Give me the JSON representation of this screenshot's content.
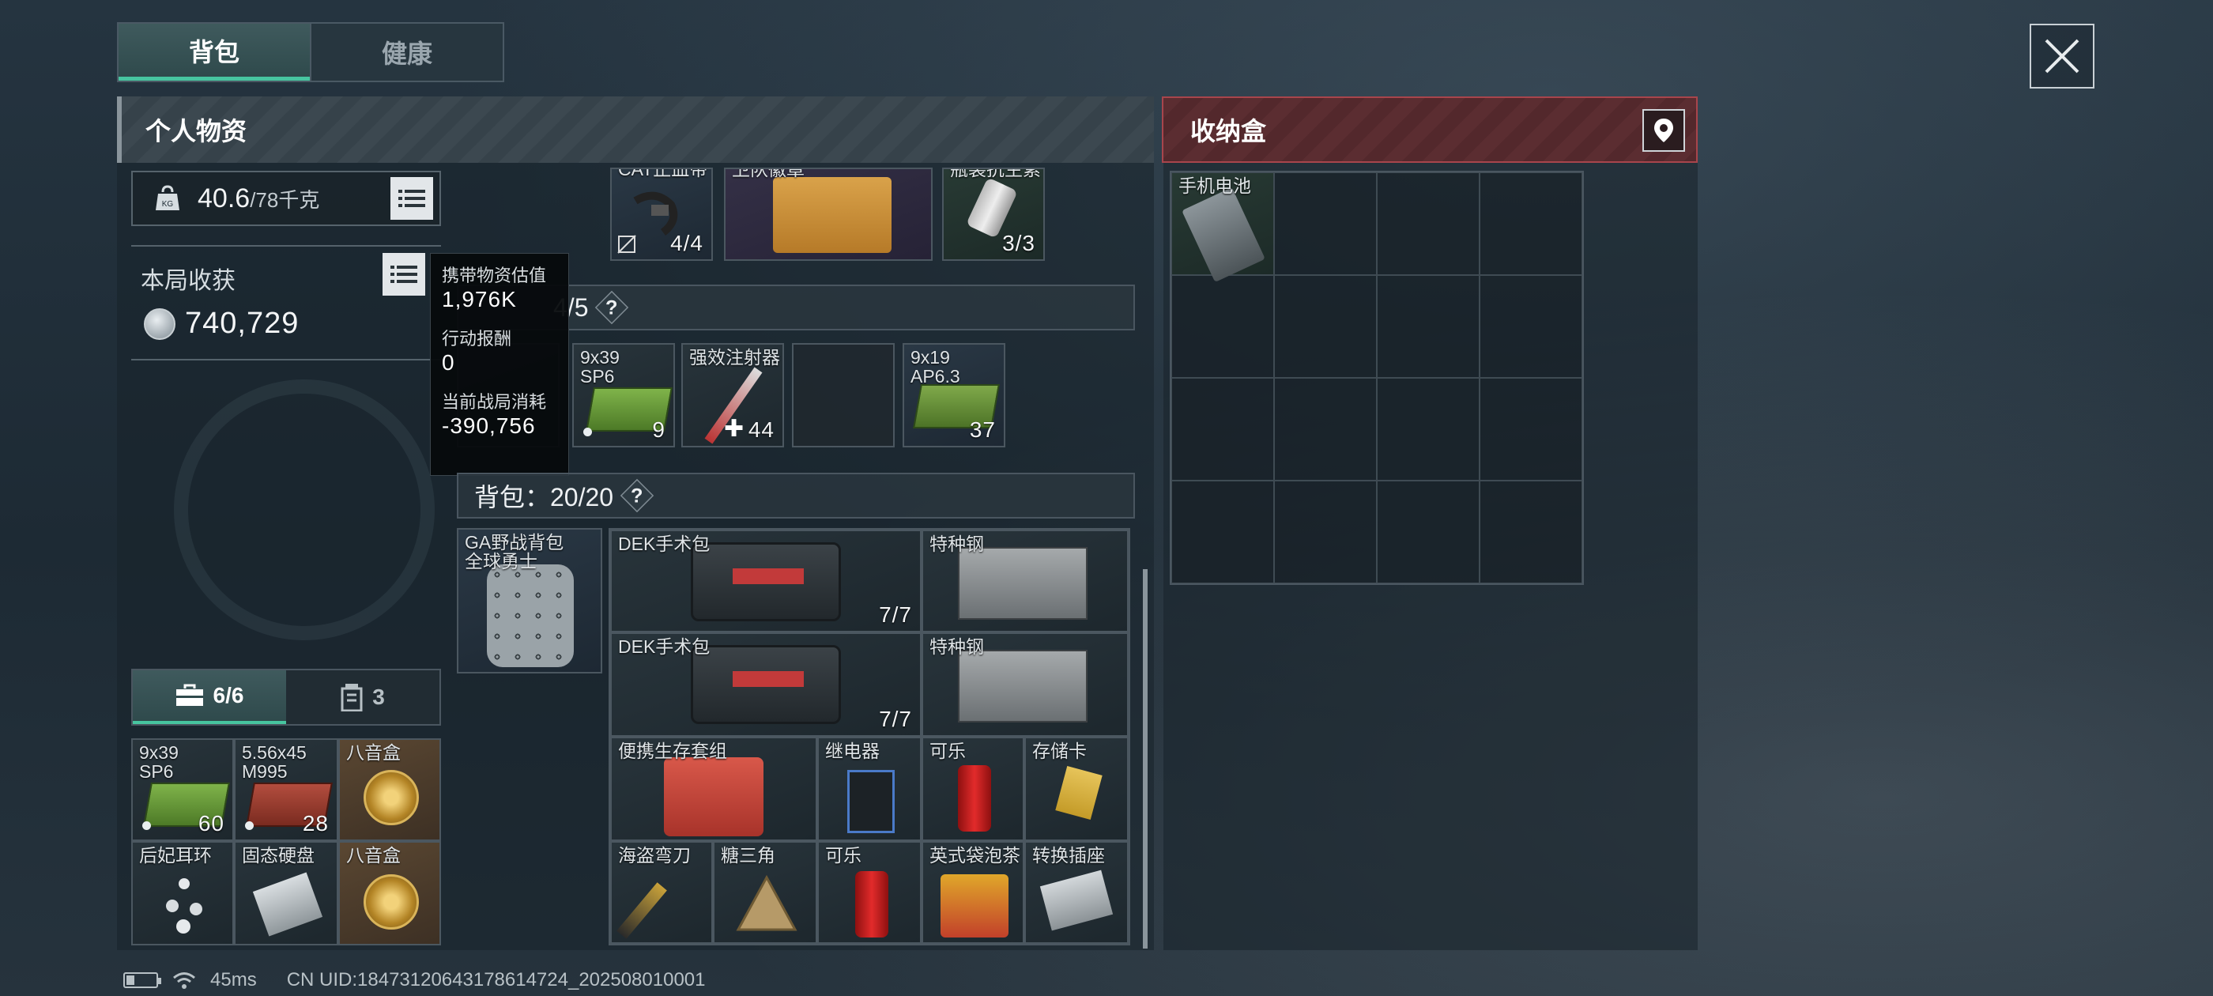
{
  "tabs": [
    {
      "label": "背包",
      "active": true
    },
    {
      "label": "健康",
      "active": false
    }
  ],
  "personal": {
    "title": "个人物资",
    "weight_current": "40.6",
    "weight_max": "/78千克",
    "harvest_label": "本局收获",
    "harvest_value": "740,729"
  },
  "tooltip": {
    "carry_label": "携带物资估值",
    "carry_value": "1,976K",
    "reward_label": "行动报酬",
    "reward_value": "0",
    "cost_label": "当前战局消耗",
    "cost_value": "-390,756"
  },
  "top_items": [
    {
      "name": "CAT止血带",
      "count": "4/4",
      "color": "#1e2a30"
    },
    {
      "name": "卫队徽章",
      "count": "",
      "color": "#332f45"
    },
    {
      "name": "瓶装抗生素",
      "count": "3/3",
      "color": "#22362f"
    }
  ],
  "rig": {
    "count_text": "4/5",
    "q": "?",
    "items": [
      {
        "name": "",
        "count": "",
        "hidden": true
      },
      {
        "name": "9x39\nSP6",
        "count": "9",
        "dot": true
      },
      {
        "name": "强效注射器",
        "count": "44",
        "plus": true
      },
      {
        "name": "",
        "count": ""
      },
      {
        "name": "9x19\nAP6.3",
        "count": "37"
      }
    ]
  },
  "backpack": {
    "label": "背包：20/20",
    "q": "?",
    "bag_name": "GA野战背包\n全球勇士",
    "items": [
      {
        "name": "DEK手术包",
        "count": "7/7"
      },
      {
        "name": "特种钢",
        "count": ""
      },
      {
        "name": "DEK手术包",
        "count": "7/7"
      },
      {
        "name": "特种钢",
        "count": ""
      },
      {
        "name": "便携生存套组",
        "count": ""
      },
      {
        "name": "继电器",
        "count": ""
      },
      {
        "name": "可乐",
        "count": ""
      },
      {
        "name": "存储卡",
        "count": ""
      },
      {
        "name": "海盗弯刀",
        "count": ""
      },
      {
        "name": "糖三角",
        "count": ""
      },
      {
        "name": "可乐",
        "count": ""
      },
      {
        "name": "英式袋泡茶",
        "count": ""
      },
      {
        "name": "转换插座",
        "count": ""
      }
    ]
  },
  "container_tabs": [
    {
      "label": "6/6",
      "icon": "toolbox-icon",
      "active": true
    },
    {
      "label": "3",
      "icon": "canister-icon",
      "active": false
    }
  ],
  "container_items": [
    {
      "name": "9x39\nSP6",
      "count": "60",
      "dot": true
    },
    {
      "name": "5.56x45\nM995",
      "count": "28",
      "dot": true
    },
    {
      "name": "八音盒",
      "count": ""
    },
    {
      "name": "后妃耳环",
      "count": ""
    },
    {
      "name": "固态硬盘",
      "count": ""
    },
    {
      "name": "八音盒",
      "count": ""
    }
  ],
  "storage_box": {
    "title": "收纳盒",
    "items": [
      {
        "name": "手机电池"
      }
    ]
  },
  "status": {
    "ping": "45ms",
    "uid": "CN UID:184731206431786147​24_202508010001"
  },
  "colors": {
    "accent": "#47c5a0",
    "box_header": "#5b2d31",
    "box_border": "#a8454c"
  }
}
